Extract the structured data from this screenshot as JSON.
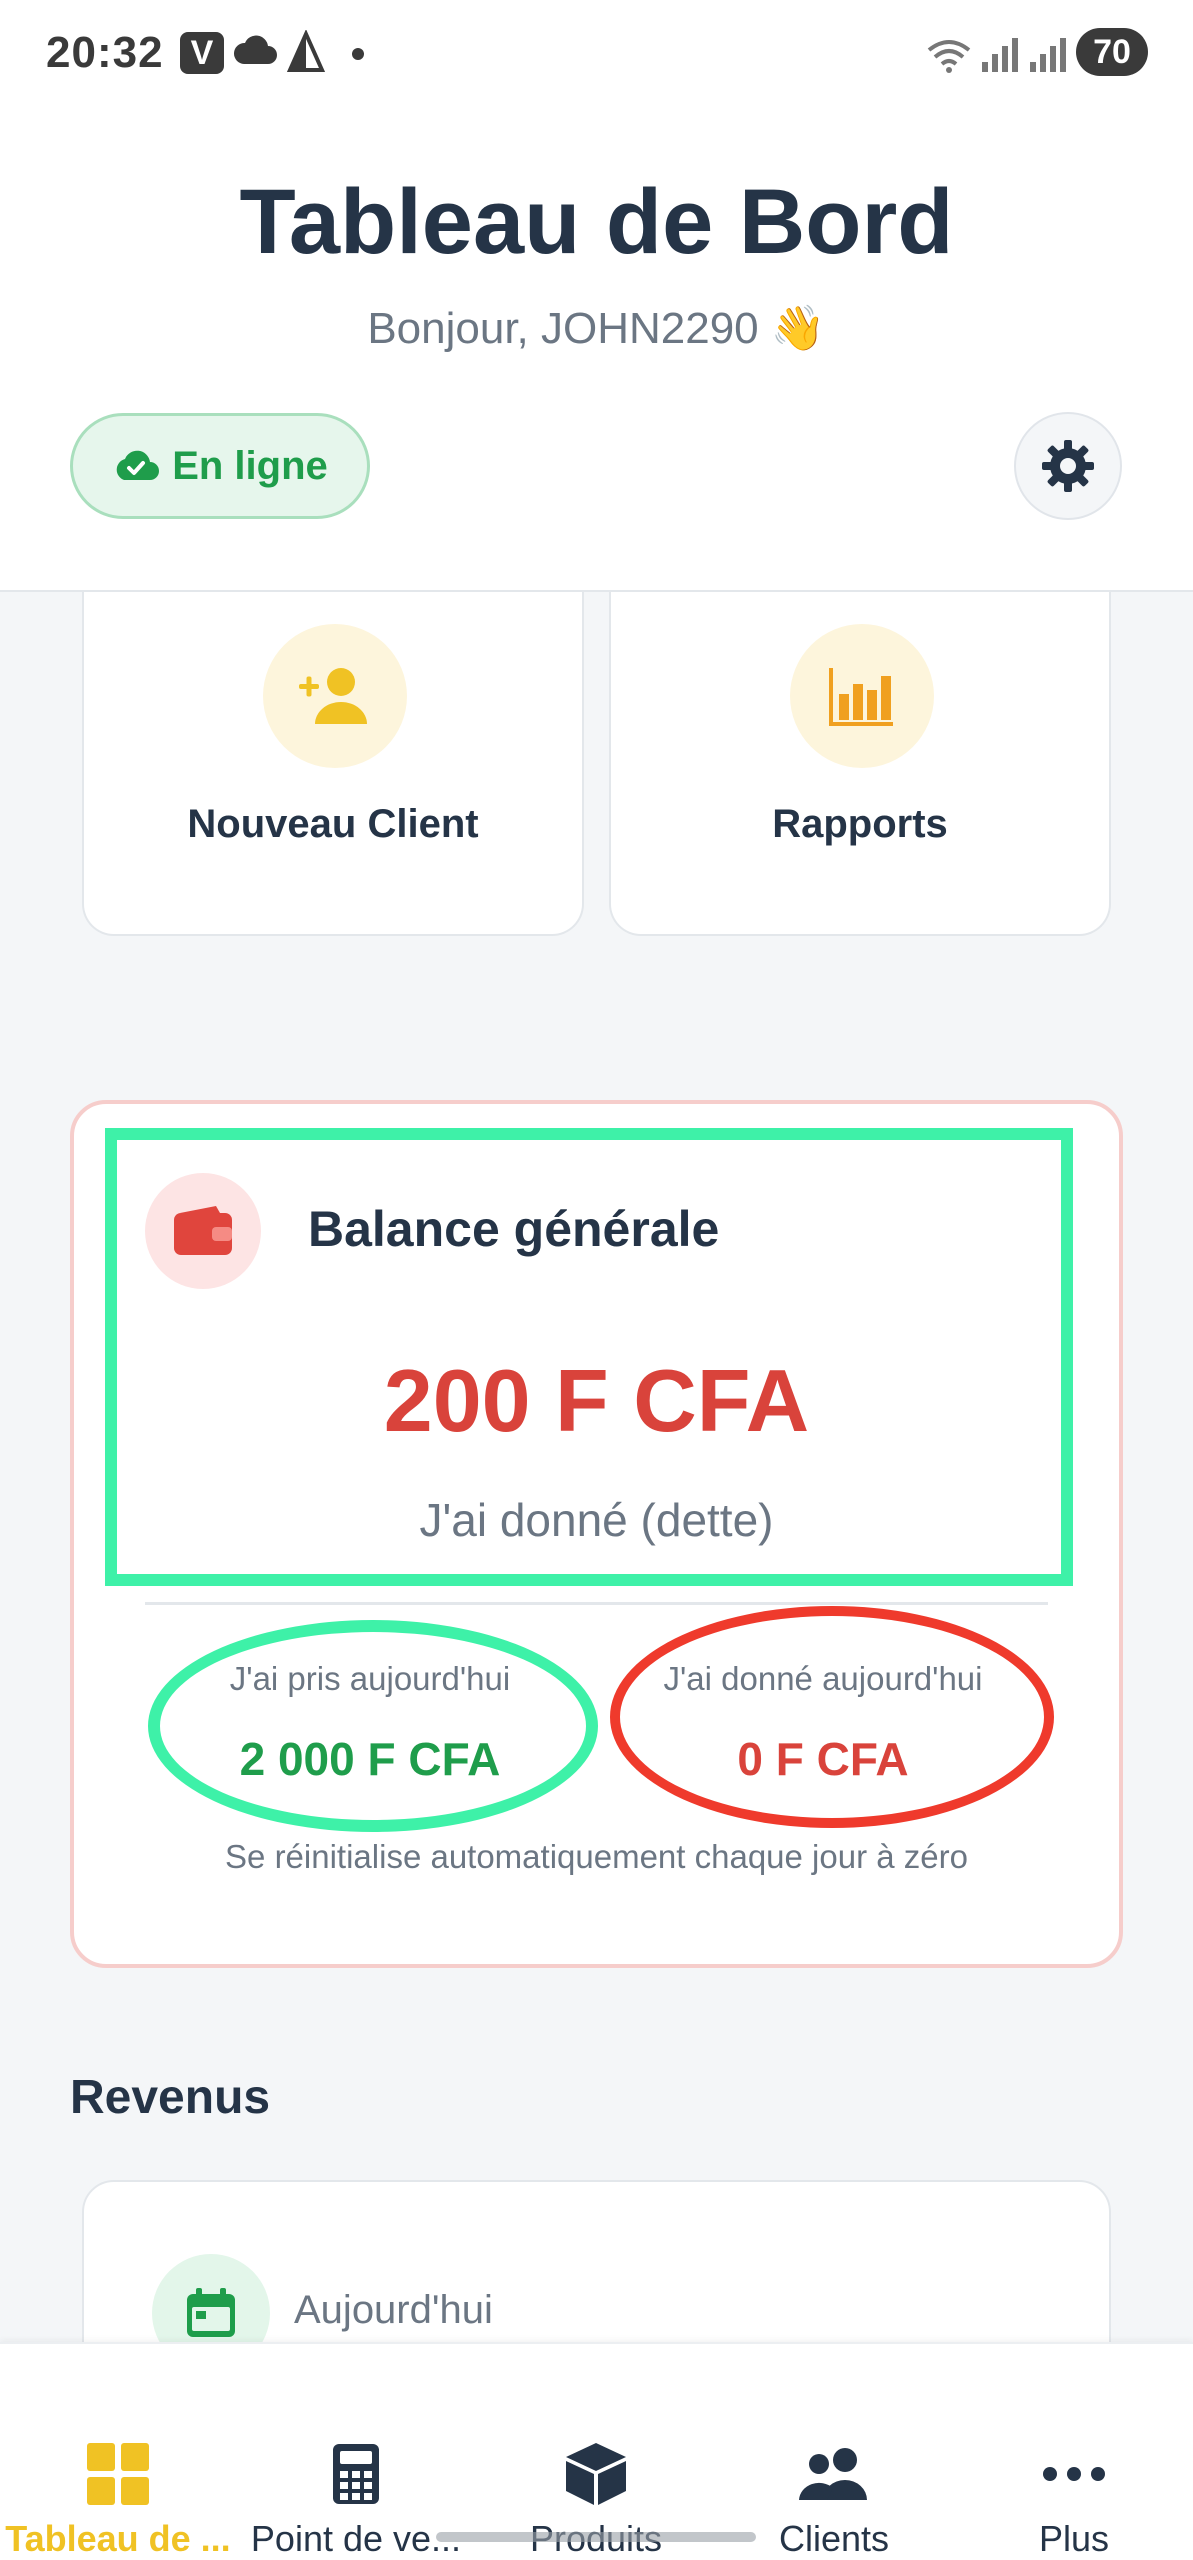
{
  "status_bar": {
    "time": "20:32",
    "carrier_badge": "V",
    "battery": "70",
    "icons": [
      "cloud-icon",
      "triangle-icon",
      "wifi-icon",
      "signal-icon",
      "signal-icon"
    ]
  },
  "header": {
    "title": "Tableau de Bord",
    "greeting": "Bonjour, JOHN2290 👋",
    "connection_status": "En ligne",
    "settings_icon": "gear-icon"
  },
  "quick_actions": [
    {
      "label": "Nouveau Client",
      "icon": "add-user-icon"
    },
    {
      "label": "Rapports",
      "icon": "bar-chart-icon"
    }
  ],
  "balance": {
    "title": "Balance générale",
    "amount": "200 F CFA",
    "caption": "J'ai donné (dette)",
    "taken_today_label": "J'ai pris aujourd'hui",
    "taken_today_value": "2 000 F CFA",
    "given_today_label": "J'ai donné aujourd'hui",
    "given_today_value": "0 F CFA",
    "reset_note": "Se réinitialise automatiquement chaque jour à zéro",
    "icon": "wallet-icon"
  },
  "revenus": {
    "title": "Revenus",
    "period_label": "Aujourd'hui",
    "icon": "calendar-icon"
  },
  "bottom_nav": [
    {
      "label": "Tableau de ...",
      "icon": "dashboard-icon",
      "active": true
    },
    {
      "label": "Point de ve...",
      "icon": "calculator-icon",
      "active": false
    },
    {
      "label": "Produits",
      "icon": "box-icon",
      "active": false
    },
    {
      "label": "Clients",
      "icon": "users-icon",
      "active": false
    },
    {
      "label": "Plus",
      "icon": "more-icon",
      "active": false
    }
  ],
  "colors": {
    "primary_text": "#253447",
    "accent_yellow": "#f0c224",
    "success_green": "#1f9d4b",
    "danger_red": "#d9433b",
    "annotation_green": "#3ef1a8",
    "annotation_red": "#ef3a2c"
  }
}
